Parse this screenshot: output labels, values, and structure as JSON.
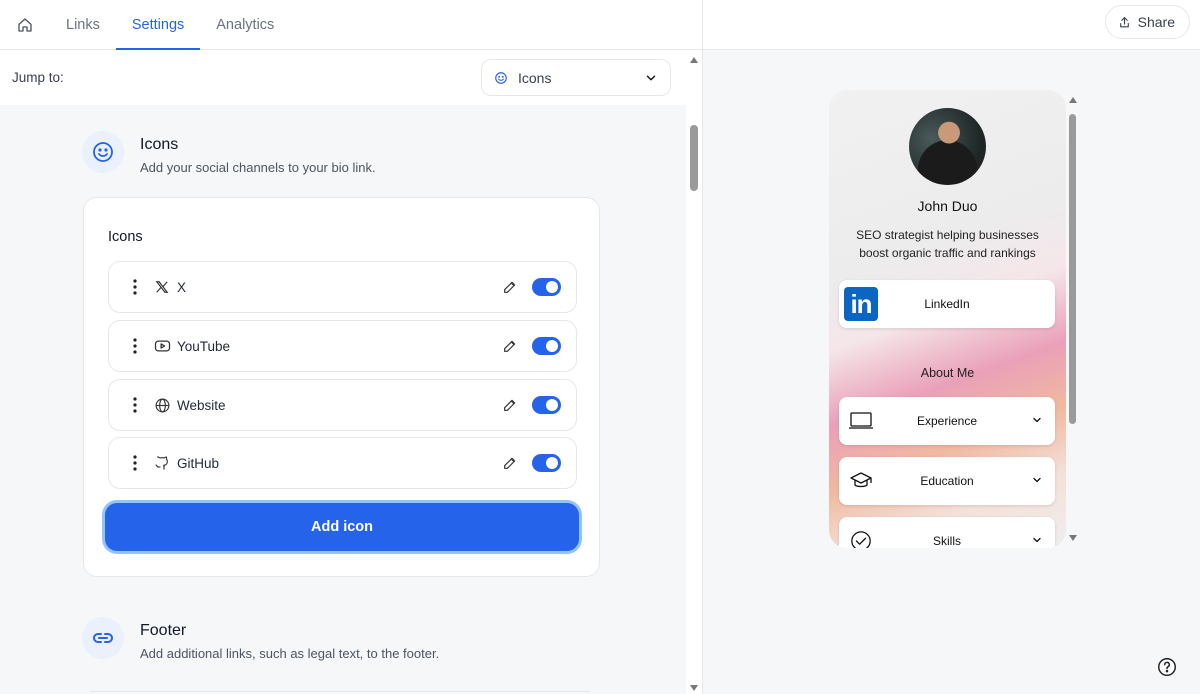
{
  "nav": {
    "tabs": [
      {
        "label": "Links"
      },
      {
        "label": "Settings"
      },
      {
        "label": "Analytics"
      }
    ],
    "share_label": "Share"
  },
  "jump": {
    "label": "Jump to:",
    "selected": "Icons"
  },
  "icons_section": {
    "title": "Icons",
    "description": "Add your social channels to your bio link."
  },
  "icons_card": {
    "title": "Icons",
    "items": [
      {
        "label": "X",
        "icon": "x-logo-icon",
        "enabled": true
      },
      {
        "label": "YouTube",
        "icon": "youtube-icon",
        "enabled": true
      },
      {
        "label": "Website",
        "icon": "globe-icon",
        "enabled": true
      },
      {
        "label": "GitHub",
        "icon": "github-icon",
        "enabled": true
      }
    ],
    "add_label": "Add icon"
  },
  "footer_section": {
    "title": "Footer",
    "description": "Add additional links, such as legal text, to the footer."
  },
  "preview": {
    "name": "John Duo",
    "bio": "SEO strategist helping businesses boost organic traffic and rankings",
    "linkedin_label": "LinkedIn",
    "about_heading": "About Me",
    "sections": [
      {
        "label": "Experience",
        "icon": "laptop-icon"
      },
      {
        "label": "Education",
        "icon": "graduation-cap-icon"
      },
      {
        "label": "Skills",
        "icon": "check-circle-icon"
      }
    ]
  },
  "colors": {
    "accent": "#2563eb",
    "linkedin": "#0a66c2"
  }
}
